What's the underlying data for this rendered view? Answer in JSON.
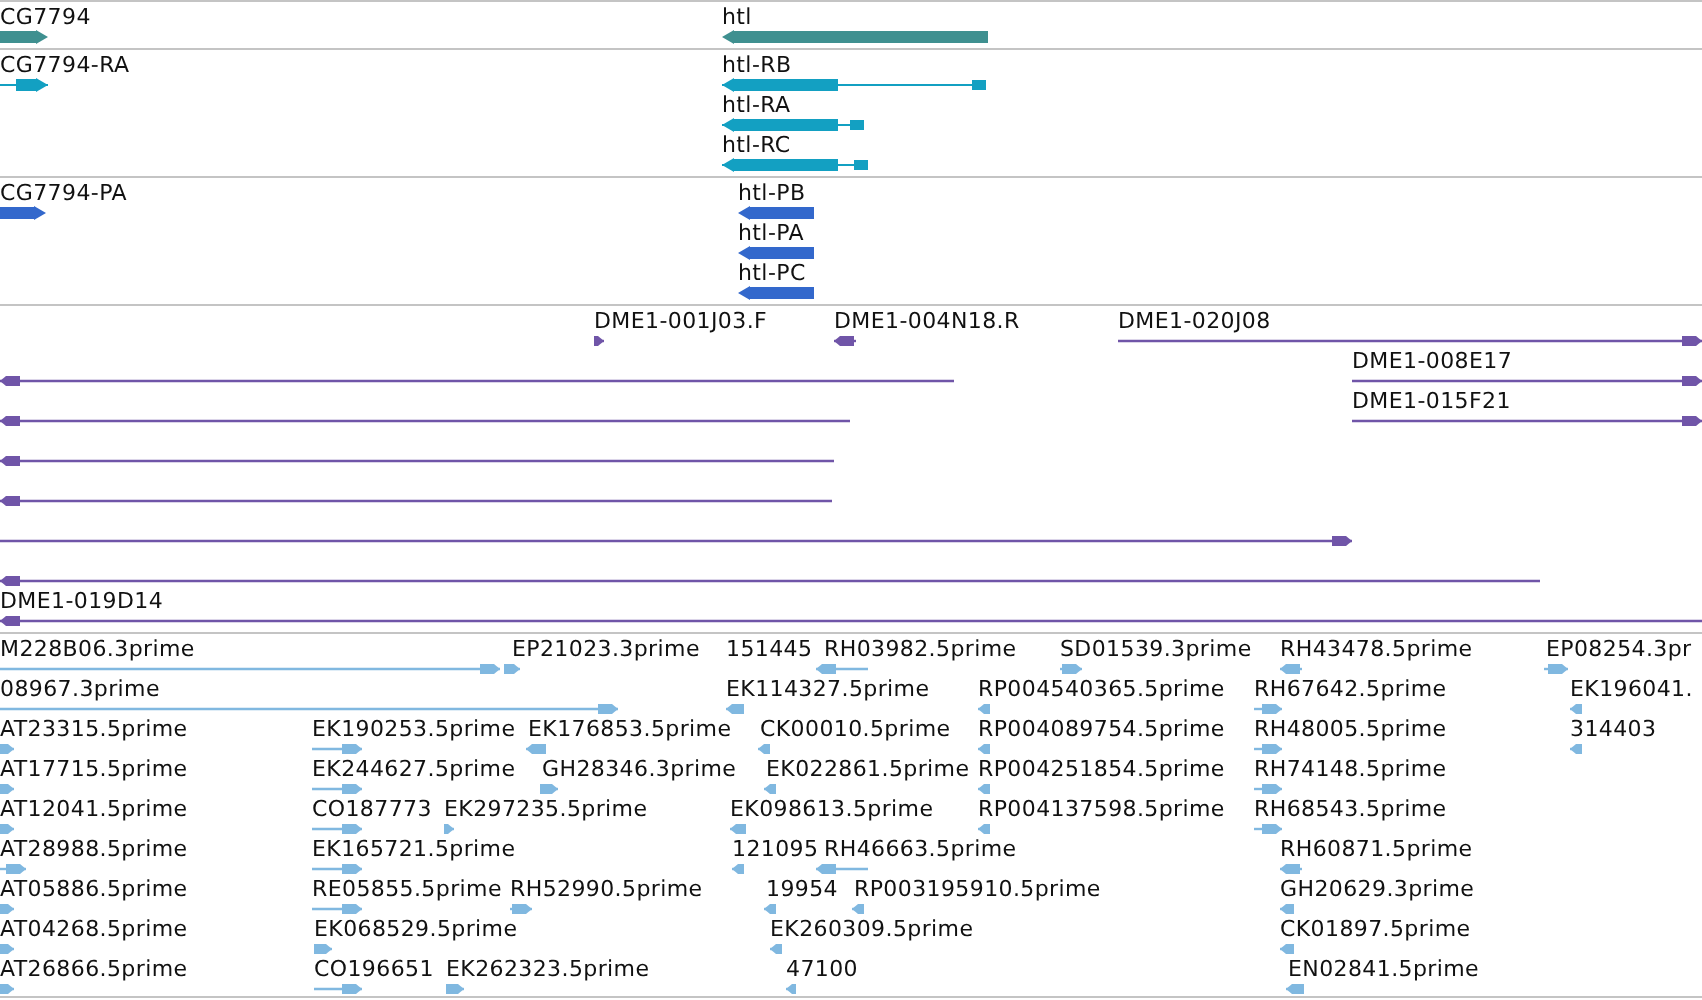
{
  "tracks": [
    {
      "kind": "gene",
      "features": [
        {
          "label": "CG7794",
          "reverse": false
        },
        {
          "label": "htl",
          "reverse": true
        }
      ]
    },
    {
      "kind": "transcript",
      "features": [
        {
          "label": "CG7794-RA",
          "reverse": false
        },
        {
          "label": "htl-RB",
          "reverse": true
        },
        {
          "label": "htl-RA",
          "reverse": true
        },
        {
          "label": "htl-RC",
          "reverse": true
        }
      ]
    },
    {
      "kind": "protein",
      "features": [
        {
          "label": "CG7794-PA",
          "reverse": false
        },
        {
          "label": "htl-PB",
          "reverse": true
        },
        {
          "label": "htl-PA",
          "reverse": true
        },
        {
          "label": "htl-PC",
          "reverse": true
        }
      ]
    },
    {
      "kind": "clone",
      "features": [
        {
          "label": "DME1-001J03.F",
          "reverse": false
        },
        {
          "label": "DME1-004N18.R",
          "reverse": true
        },
        {
          "label": "DME1-020J08",
          "reverse": false
        },
        {
          "reverse": true
        },
        {
          "label": "DME1-008E17",
          "reverse": false
        },
        {
          "reverse": true
        },
        {
          "label": "DME1-015F21",
          "reverse": false
        },
        {
          "reverse": true
        },
        {
          "reverse": true
        },
        {
          "reverse": false
        },
        {
          "reverse": true
        },
        {
          "label": "DME1-019D14",
          "reverse": true
        }
      ]
    },
    {
      "kind": "est",
      "features": [
        {
          "label": "M228B06.3prime",
          "reverse": false
        },
        {
          "label": "EP21023.3prime",
          "reverse": false
        },
        {
          "label": "151445"
        },
        {
          "label": "RH03982.5prime",
          "reverse": true
        },
        {
          "label": "SD01539.3prime",
          "reverse": false
        },
        {
          "label": "RH43478.5prime",
          "reverse": true
        },
        {
          "label": "EP08254.3pr",
          "reverse": false
        },
        {
          "label": "08967.3prime",
          "reverse": false
        },
        {
          "label": "EK114327.5prime",
          "reverse": true
        },
        {
          "label": "RP004540365.5prime",
          "reverse": true
        },
        {
          "label": "RH67642.5prime",
          "reverse": false
        },
        {
          "label": "EK196041.",
          "reverse": true
        },
        {
          "label": "AT23315.5prime",
          "reverse": false
        },
        {
          "label": "EK190253.5prime",
          "reverse": false
        },
        {
          "label": "EK176853.5prime",
          "reverse": true
        },
        {
          "label": "CK00010.5prime",
          "reverse": true
        },
        {
          "label": "RP004089754.5prime",
          "reverse": true
        },
        {
          "label": "RH48005.5prime",
          "reverse": false
        },
        {
          "label": "314403",
          "reverse": true
        },
        {
          "label": "AT17715.5prime",
          "reverse": false
        },
        {
          "label": "EK244627.5prime",
          "reverse": false
        },
        {
          "label": "GH28346.3prime",
          "reverse": false
        },
        {
          "label": "EK022861.5prime",
          "reverse": true
        },
        {
          "label": "RP004251854.5prime",
          "reverse": true
        },
        {
          "label": "RH74148.5prime",
          "reverse": false
        },
        {
          "label": "AT12041.5prime",
          "reverse": false
        },
        {
          "label": "CO187773",
          "reverse": false
        },
        {
          "label": "EK297235.5prime",
          "reverse": false
        },
        {
          "label": "EK098613.5prime",
          "reverse": true
        },
        {
          "label": "RP004137598.5prime",
          "reverse": true
        },
        {
          "label": "RH68543.5prime",
          "reverse": false
        },
        {
          "label": "AT28988.5prime",
          "reverse": false
        },
        {
          "label": "EK165721.5prime",
          "reverse": false
        },
        {
          "label": "121095",
          "reverse": true
        },
        {
          "label": "RH46663.5prime",
          "reverse": true
        },
        {
          "label": "RH60871.5prime",
          "reverse": true
        },
        {
          "label": "AT05886.5prime",
          "reverse": false
        },
        {
          "label": "RE05855.5prime",
          "reverse": false
        },
        {
          "label": "RH52990.5prime",
          "reverse": false
        },
        {
          "label": "19954",
          "reverse": true
        },
        {
          "label": "RP003195910.5prime",
          "reverse": true
        },
        {
          "label": "GH20629.3prime",
          "reverse": true
        },
        {
          "label": "AT04268.5prime",
          "reverse": false
        },
        {
          "label": "EK068529.5prime",
          "reverse": false
        },
        {
          "label": "EK260309.5prime",
          "reverse": true
        },
        {
          "label": "CK01897.5prime",
          "reverse": true
        },
        {
          "label": "AT26866.5prime",
          "reverse": false
        },
        {
          "label": "CO196651",
          "reverse": false
        },
        {
          "label": "EK262323.5prime",
          "reverse": false
        },
        {
          "label": "47100",
          "reverse": true
        },
        {
          "label": "EN02841.5prime",
          "reverse": true
        }
      ]
    }
  ]
}
